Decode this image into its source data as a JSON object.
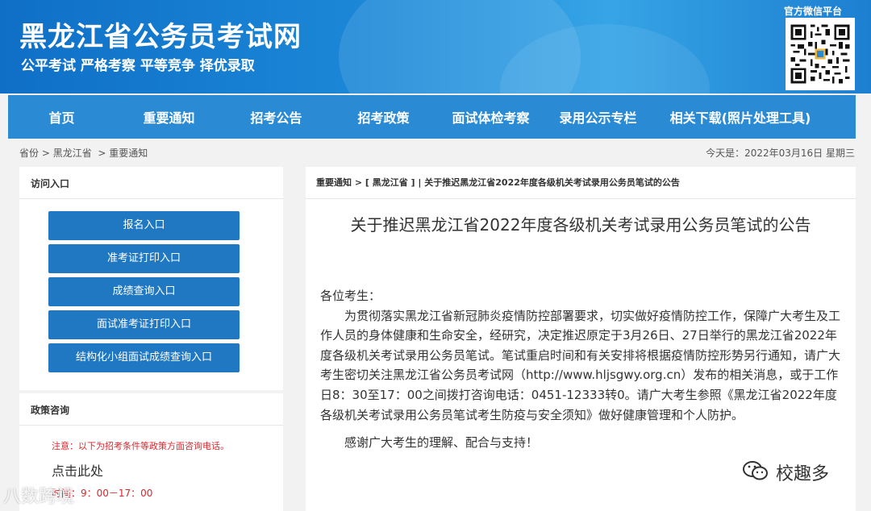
{
  "header": {
    "site_title": "黑龙江省公务员考试网",
    "slogan": "公平考试 严格考察 平等竞争 择优录取",
    "wechat_label": "官方微信平台",
    "qr_icon": "qr-code-icon"
  },
  "nav": {
    "items": [
      {
        "label": "首页"
      },
      {
        "label": "重要通知"
      },
      {
        "label": "招考公告"
      },
      {
        "label": "招考政策"
      },
      {
        "label": "面试体检考察"
      },
      {
        "label": "录用公示专栏"
      },
      {
        "label": "相关下载(照片处理工具)"
      }
    ]
  },
  "breadcrumb": {
    "item1": "省份",
    "sep1": ">",
    "item2": "黑龙江省",
    "sep2": ">",
    "item3": "重要通知",
    "today": "今天是：2022年03月16日 星期三"
  },
  "left": {
    "access_title": "访问入口",
    "buttons": [
      {
        "label": "报名入口"
      },
      {
        "label": "准考证打印入口"
      },
      {
        "label": "成绩查询入口"
      },
      {
        "label": "面试准考证打印入口"
      },
      {
        "label": "结构化小组面试成绩查询入口"
      }
    ],
    "policy_title": "政策咨询",
    "notice": "注意：以下为招考条件等政策方面咨询电话。",
    "click_here": "点击此处",
    "time_text": "时间：9：00－17：00"
  },
  "article": {
    "crumb": "重要通知 > [ 黑龙江省 ] | 关于推迟黑龙江省2022年度各级机关考试录用公务员笔试的公告",
    "title": "关于推迟黑龙江省2022年度各级机关考试录用公务员笔试的公告",
    "greeting": "各位考生：",
    "para1": "为贯彻落实黑龙江省新冠肺炎疫情防控部署要求，切实做好疫情防控工作，保障广大考生及工作人员的身体健康和生命安全，经研究，决定推迟原定于3月26日、27日举行的黑龙江省2022年度各级机关考试录用公务员笔试。笔试重启时间和有关安排将根据疫情防控形势另行通知，请广大考生密切关注黑龙江省公务员考试网（http://www.hljsgwy.org.cn）发布的相关消息，或于工作日8：30至17：00之间拨打咨询电话：0451-12333转0。请广大考生参照《黑龙江省2022年度各级机关考试录用公务员笔试考生防疫与安全须知》做好健康管理和个人防护。",
    "thanks": "感谢广大考生的理解、配合与支持！"
  },
  "watermarks": {
    "left": "八数跨境",
    "right": "校趣多",
    "right_icon": "wechat-icon"
  }
}
